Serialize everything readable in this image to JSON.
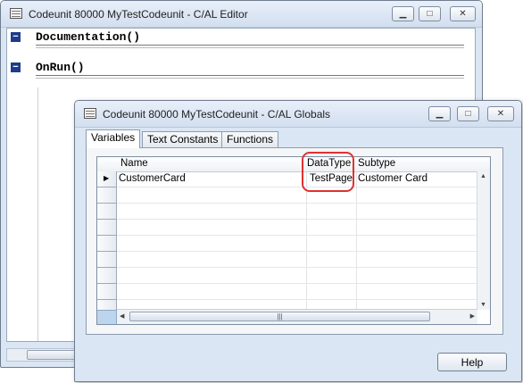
{
  "editor_window": {
    "title": "Codeunit 80000 MyTestCodeunit - C/AL Editor",
    "buttons": {
      "minimize": "▁",
      "maximize": "□",
      "close": "✕"
    },
    "sections": [
      {
        "collapse_symbol": "⊟",
        "label": "Documentation()"
      },
      {
        "collapse_symbol": "⊟",
        "label": "OnRun()"
      }
    ]
  },
  "globals_window": {
    "title": "Codeunit 80000 MyTestCodeunit - C/AL Globals",
    "buttons": {
      "minimize": "▁",
      "maximize": "□",
      "close": "✕"
    },
    "tabs": [
      {
        "label": "Variables",
        "active": true
      },
      {
        "label": "Text Constants",
        "active": false
      },
      {
        "label": "Functions",
        "active": false
      }
    ],
    "grid": {
      "columns": [
        "Name",
        "DataType",
        "Subtype"
      ],
      "rows": [
        {
          "indicator": "▶",
          "name": "CustomerCard",
          "datatype": "TestPage",
          "subtype": "Customer Card"
        }
      ],
      "empty_row_count": 8,
      "hscroll_grip": "|||"
    },
    "help_label": "Help"
  },
  "colors": {
    "highlight": "#e03131",
    "title_bar": "#dbe6f4"
  }
}
